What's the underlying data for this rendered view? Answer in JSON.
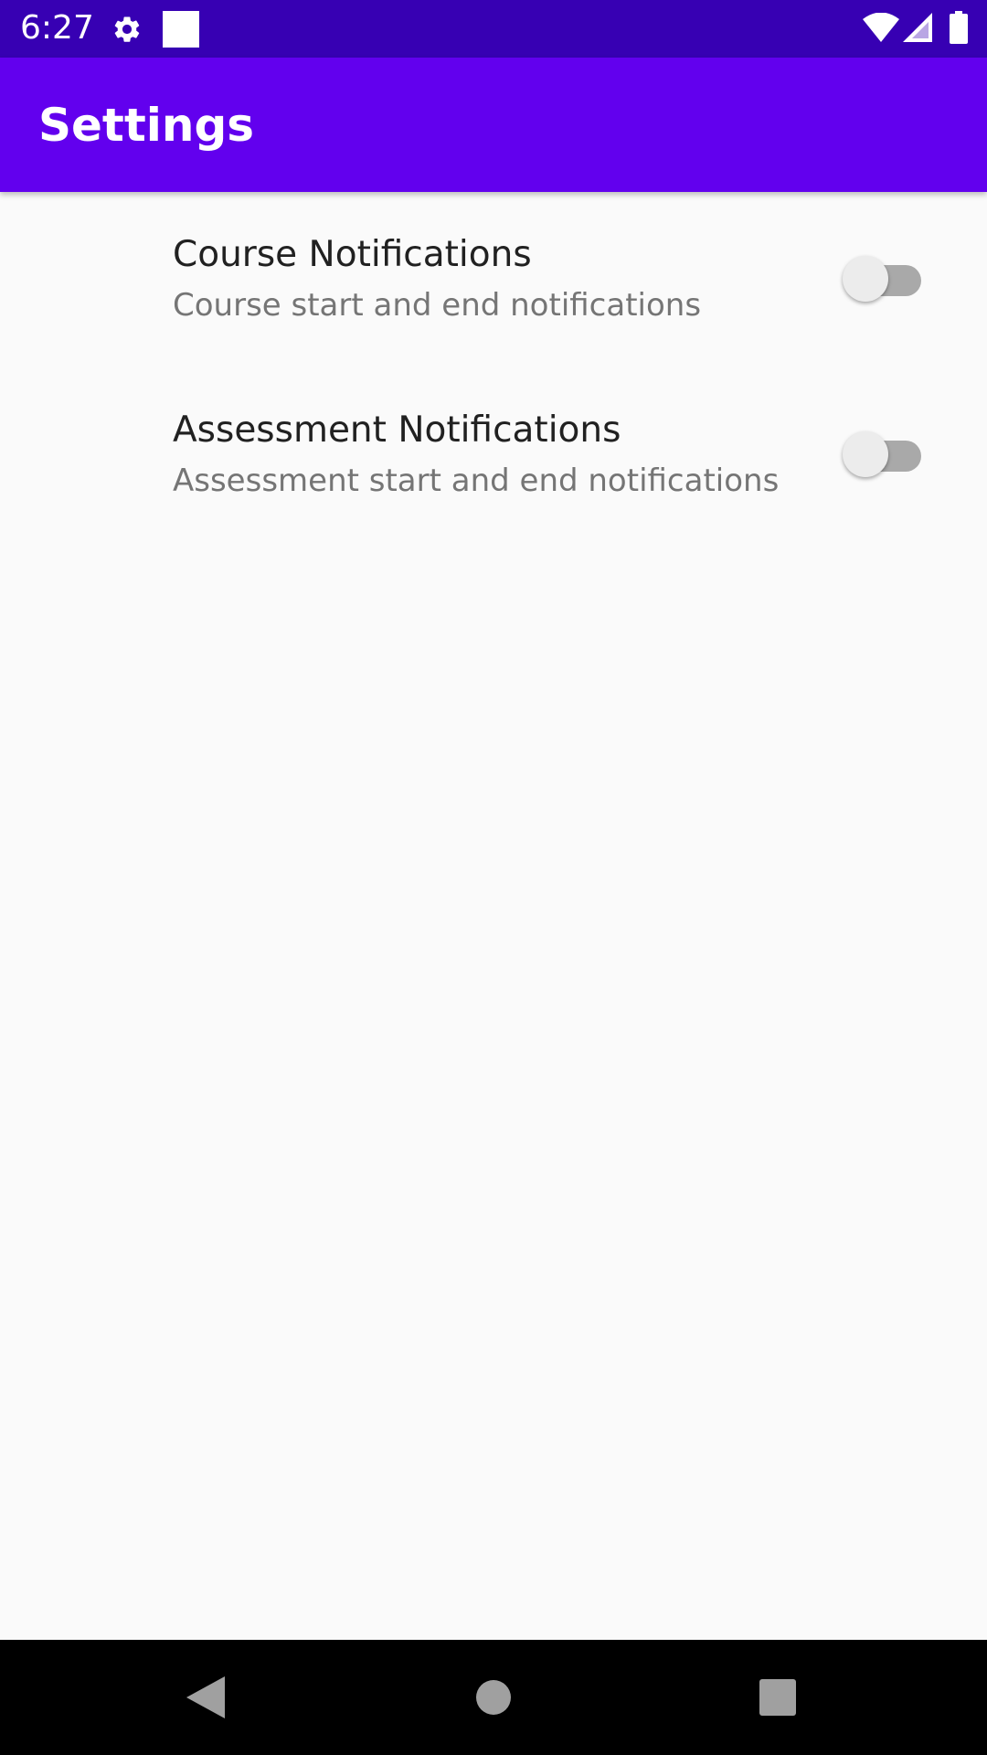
{
  "status_bar": {
    "time": "6:27",
    "icons": [
      "gear-icon",
      "square-notification-icon",
      "wifi-icon",
      "cell-signal-icon",
      "battery-icon"
    ]
  },
  "app_bar": {
    "title": "Settings",
    "background": "#6200ee",
    "status_background": "#3700b3"
  },
  "preferences": [
    {
      "title": "Course Notifications",
      "summary": "Course start and end notifications",
      "enabled": false
    },
    {
      "title": "Assessment Notifications",
      "summary": "Assessment start and end notifications",
      "enabled": false
    }
  ],
  "nav_bar": {
    "buttons": [
      "back-icon",
      "home-icon",
      "recents-icon"
    ]
  }
}
